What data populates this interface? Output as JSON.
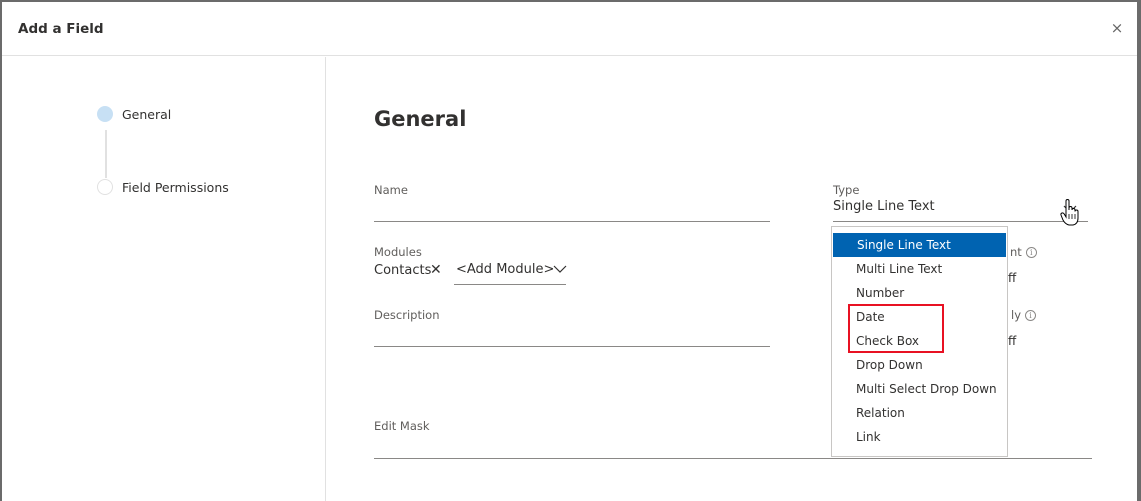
{
  "dialog": {
    "title": "Add a Field",
    "close_icon": "×"
  },
  "steps": [
    {
      "label": "General",
      "state": "active"
    },
    {
      "label": "Field Permissions",
      "state": "inactive"
    }
  ],
  "main": {
    "section_title": "General",
    "fields": {
      "name": {
        "label": "Name",
        "value": ""
      },
      "modules": {
        "label": "Modules",
        "chips": [
          {
            "label": "Contacts",
            "remove_icon": "✕"
          }
        ],
        "add_placeholder": "<Add Module>"
      },
      "description": {
        "label": "Description",
        "value": ""
      },
      "edit_mask": {
        "label": "Edit Mask",
        "value": ""
      },
      "type": {
        "label": "Type",
        "value": "Single Line Text"
      }
    },
    "partially_hidden": {
      "toggle1_label_tail": "nt",
      "toggle1_value_tail": "ff",
      "toggle2_label_tail": "ly",
      "toggle2_value_tail": "ff",
      "info_icon": "i"
    }
  },
  "type_dropdown": {
    "options": [
      "Single Line Text",
      "Multi Line Text",
      "Number",
      "Date",
      "Check Box",
      "Drop Down",
      "Multi Select Drop Down",
      "Relation",
      "Link"
    ],
    "selected": "Single Line Text",
    "highlighted_options": [
      "Date",
      "Check Box"
    ],
    "highlight_color": "#e81123",
    "selected_color": "#0063b1"
  }
}
